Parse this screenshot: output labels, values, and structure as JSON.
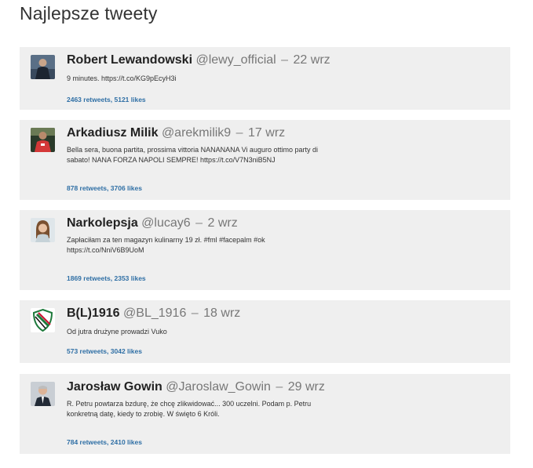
{
  "page": {
    "title": "Najlepsze tweety"
  },
  "colors": {
    "card_bg": "#efefef",
    "link": "#2f6fa5",
    "muted": "#777777"
  },
  "tweets": [
    {
      "name": "Robert Lewandowski",
      "handle": "@lewy_official",
      "separator": "–",
      "date": "22 wrz",
      "text": "9 minutes. https://t.co/KG9pEcyH3i",
      "stats": "2463 retweets, 5121 likes",
      "avatar_icon": "person-photo-icon"
    },
    {
      "name": "Arkadiusz Milik",
      "handle": "@arekmilik9",
      "separator": "–",
      "date": "17 wrz",
      "text": "Bella sera, buona partita, prossima vittoria NANANANA Vi auguro ottimo party di sabato! NANA FORZA NAPOLI SEMPRE! https://t.co/V7N3niB5NJ",
      "stats": "878 retweets, 3706 likes",
      "avatar_icon": "person-photo-icon"
    },
    {
      "name": "Narkolepsja",
      "handle": "@lucay6",
      "separator": "–",
      "date": "2 wrz",
      "text": "Zapłaciłam za ten magazyn kulinarny 19 zł.  #fml #facepalm #ok https://t.co/NniV6B9UoM",
      "stats": "1869 retweets, 2353 likes",
      "avatar_icon": "person-photo-icon"
    },
    {
      "name": "B(L)1916",
      "handle": "@BL_1916",
      "separator": "–",
      "date": "18 wrz",
      "text": "Od jutra drużyne prowadzi Vuko",
      "stats": "573 retweets, 3042 likes",
      "avatar_icon": "club-crest-icon"
    },
    {
      "name": "Jarosław Gowin",
      "handle": "@Jaroslaw_Gowin",
      "separator": "–",
      "date": "29 wrz",
      "text": "R. Petru powtarza bzdurę, że chcę zlikwidować... 300 uczelni. Podam p. Petru konkretną datę, kiedy to zrobię. W święto 6 Króli.",
      "stats": "784 retweets, 2410 likes",
      "avatar_icon": "person-photo-icon"
    }
  ]
}
